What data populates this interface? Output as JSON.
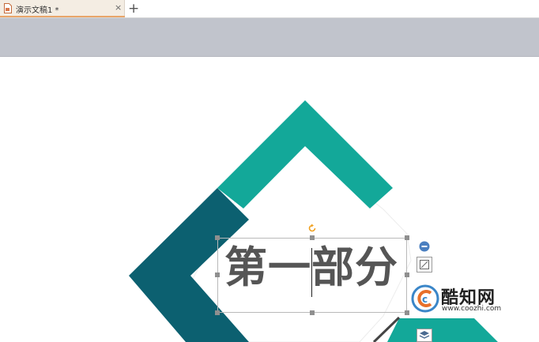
{
  "tabs": [
    {
      "title": "演示文稿1 *",
      "active": true
    }
  ],
  "tab_close_label": "×",
  "new_tab_label": "+",
  "slide": {
    "title_text": "第一部分",
    "colors": {
      "teal_light": "#13a899",
      "teal_dark": "#0c6070",
      "text": "#555555"
    }
  },
  "watermark": {
    "name": "酷知网",
    "url": "www.coozhi.com"
  },
  "icons": {
    "tab": "document-icon",
    "rotate": "rotate-icon",
    "collapse": "minus-circle-icon",
    "effects": "shape-format-icon",
    "layers": "layers-icon"
  }
}
